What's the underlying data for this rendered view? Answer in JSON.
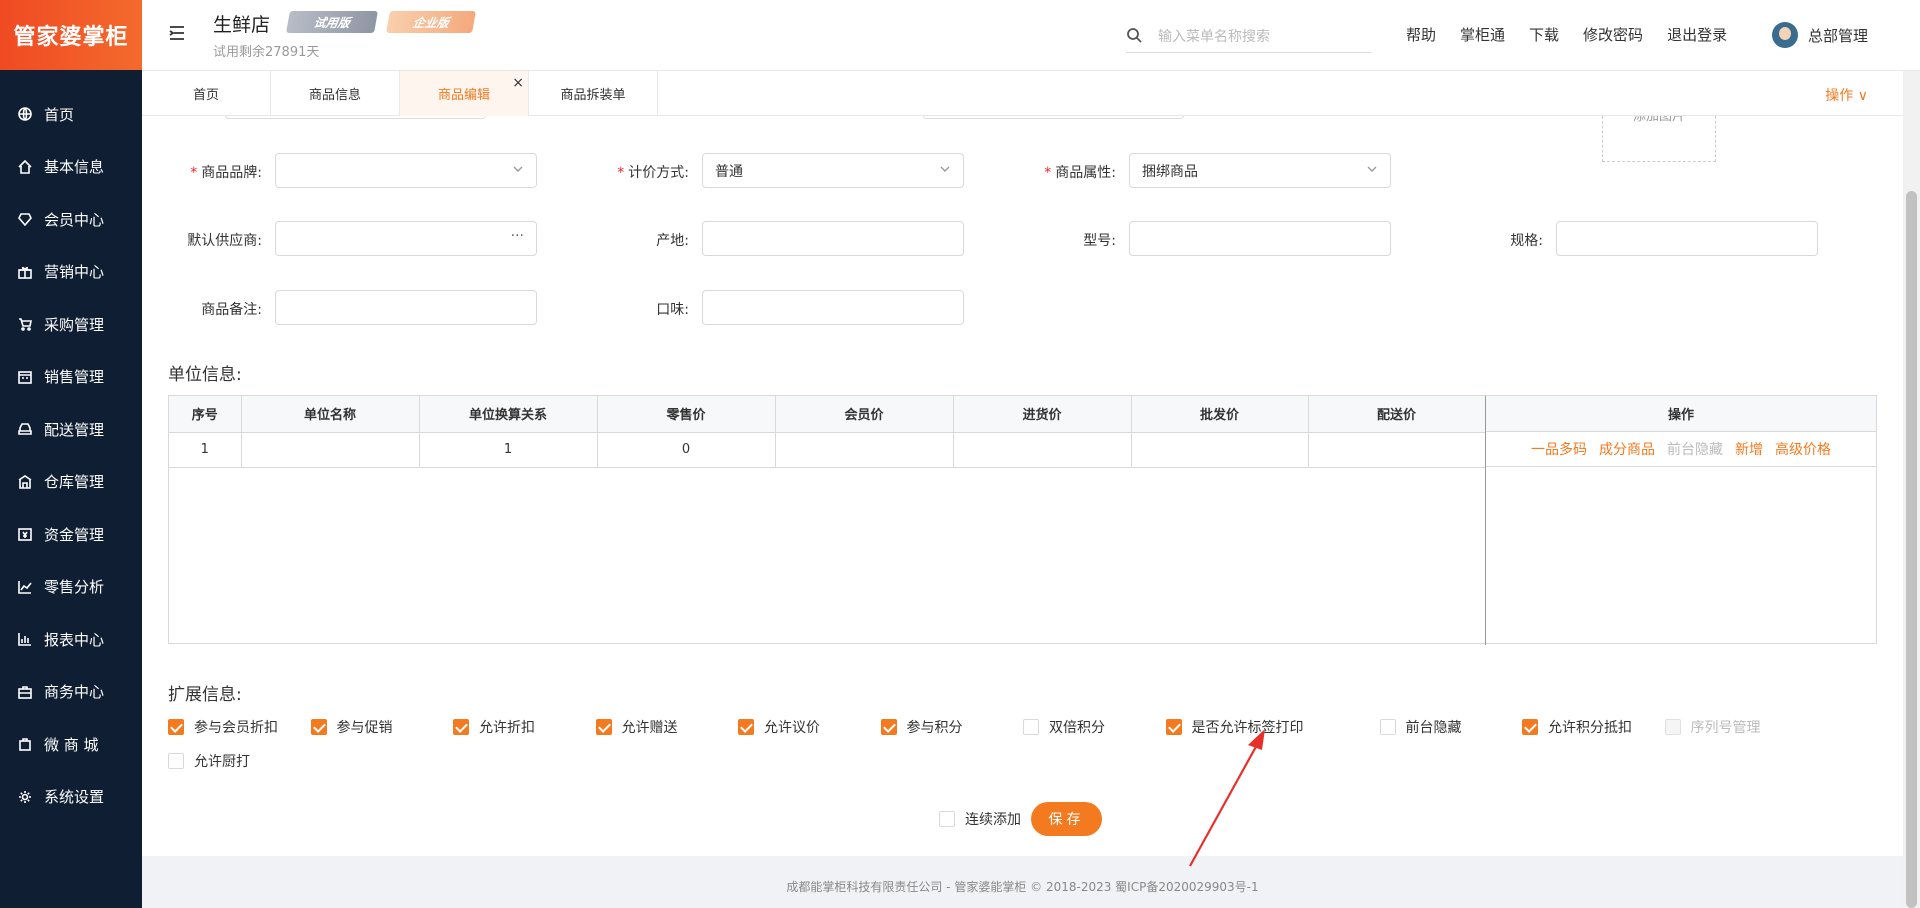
{
  "brand": {
    "logo_text": "管家婆掌柜"
  },
  "sidebar": {
    "items": [
      {
        "label": "首页",
        "icon": "globe-icon"
      },
      {
        "label": "基本信息",
        "icon": "home-icon"
      },
      {
        "label": "会员中心",
        "icon": "diamond-icon"
      },
      {
        "label": "营销中心",
        "icon": "gift-icon"
      },
      {
        "label": "采购管理",
        "icon": "cart-icon"
      },
      {
        "label": "销售管理",
        "icon": "calendar-icon"
      },
      {
        "label": "配送管理",
        "icon": "car-icon"
      },
      {
        "label": "仓库管理",
        "icon": "warehouse-icon"
      },
      {
        "label": "资金管理",
        "icon": "money-icon"
      },
      {
        "label": "零售分析",
        "icon": "chart-icon"
      },
      {
        "label": "报表中心",
        "icon": "bar-chart-icon"
      },
      {
        "label": "商务中心",
        "icon": "briefcase-icon"
      },
      {
        "label": "微 商 城",
        "icon": "bag-icon"
      },
      {
        "label": "系统设置",
        "icon": "gear-icon"
      }
    ]
  },
  "header": {
    "store_name": "生鲜店",
    "badge_trial": "试用版",
    "badge_enterprise": "企业版",
    "trial_remaining": "试用剩余27891天",
    "search_placeholder": "输入菜单名称搜索",
    "links": [
      "帮助",
      "掌柜通",
      "下载",
      "修改密码",
      "退出登录"
    ],
    "user_name": "总部管理"
  },
  "tabs": {
    "items": [
      "首页",
      "商品信息",
      "商品编辑",
      "商品拆装单"
    ],
    "active_index": 2,
    "close_symbol": "×",
    "operations": "操作 ∨"
  },
  "form": {
    "add_image": "添加图片",
    "brand_label": "商品品牌",
    "brand_value": "",
    "pricing_label": "计价方式",
    "pricing_value": "普通",
    "attribute_label": "商品属性",
    "attribute_value": "捆绑商品",
    "supplier_label": "默认供应商",
    "supplier_dots": "···",
    "origin_label": "产地",
    "model_label": "型号",
    "spec_label": "规格",
    "remark_label": "商品备注",
    "flavor_label": "口味"
  },
  "units": {
    "title": "单位信息:",
    "columns": [
      "序号",
      "单位名称",
      "单位换算关系",
      "零售价",
      "会员价",
      "进货价",
      "批发价",
      "配送价"
    ],
    "ops_header": "操作",
    "rows": [
      {
        "cells": [
          "1",
          "",
          "1",
          "0",
          "",
          "",
          "",
          ""
        ]
      }
    ],
    "actions": [
      {
        "label": "一品多码",
        "enabled": true
      },
      {
        "label": "成分商品",
        "enabled": true
      },
      {
        "label": "前台隐藏",
        "enabled": false
      },
      {
        "label": "新增",
        "enabled": true
      },
      {
        "label": "高级价格",
        "enabled": true
      }
    ]
  },
  "extension": {
    "title": "扩展信息:",
    "options_row1": [
      {
        "label": "参与会员折扣",
        "checked": true
      },
      {
        "label": "参与促销",
        "checked": true
      },
      {
        "label": "允许折扣",
        "checked": true
      },
      {
        "label": "允许赠送",
        "checked": true
      },
      {
        "label": "允许议价",
        "checked": true
      },
      {
        "label": "参与积分",
        "checked": true
      },
      {
        "label": "双倍积分",
        "checked": false
      },
      {
        "label": "是否允许标签打印",
        "checked": true
      },
      {
        "label": "前台隐藏",
        "checked": false
      },
      {
        "label": "允许积分抵扣",
        "checked": true
      },
      {
        "label": "序列号管理",
        "checked": false,
        "disabled": true
      }
    ],
    "options_row2": [
      {
        "label": "允许厨打",
        "checked": false
      }
    ]
  },
  "actions": {
    "continuous_add": "连续添加",
    "save": "保存"
  },
  "footer": {
    "text": "成都能掌柜科技有限责任公司 - 管家婆能掌柜 © 2018-2023 蜀ICP备2020029903号-1"
  },
  "colors": {
    "accent": "#f47a20",
    "sidebar_bg": "#0f1e33",
    "annotation": "#e8302a"
  }
}
